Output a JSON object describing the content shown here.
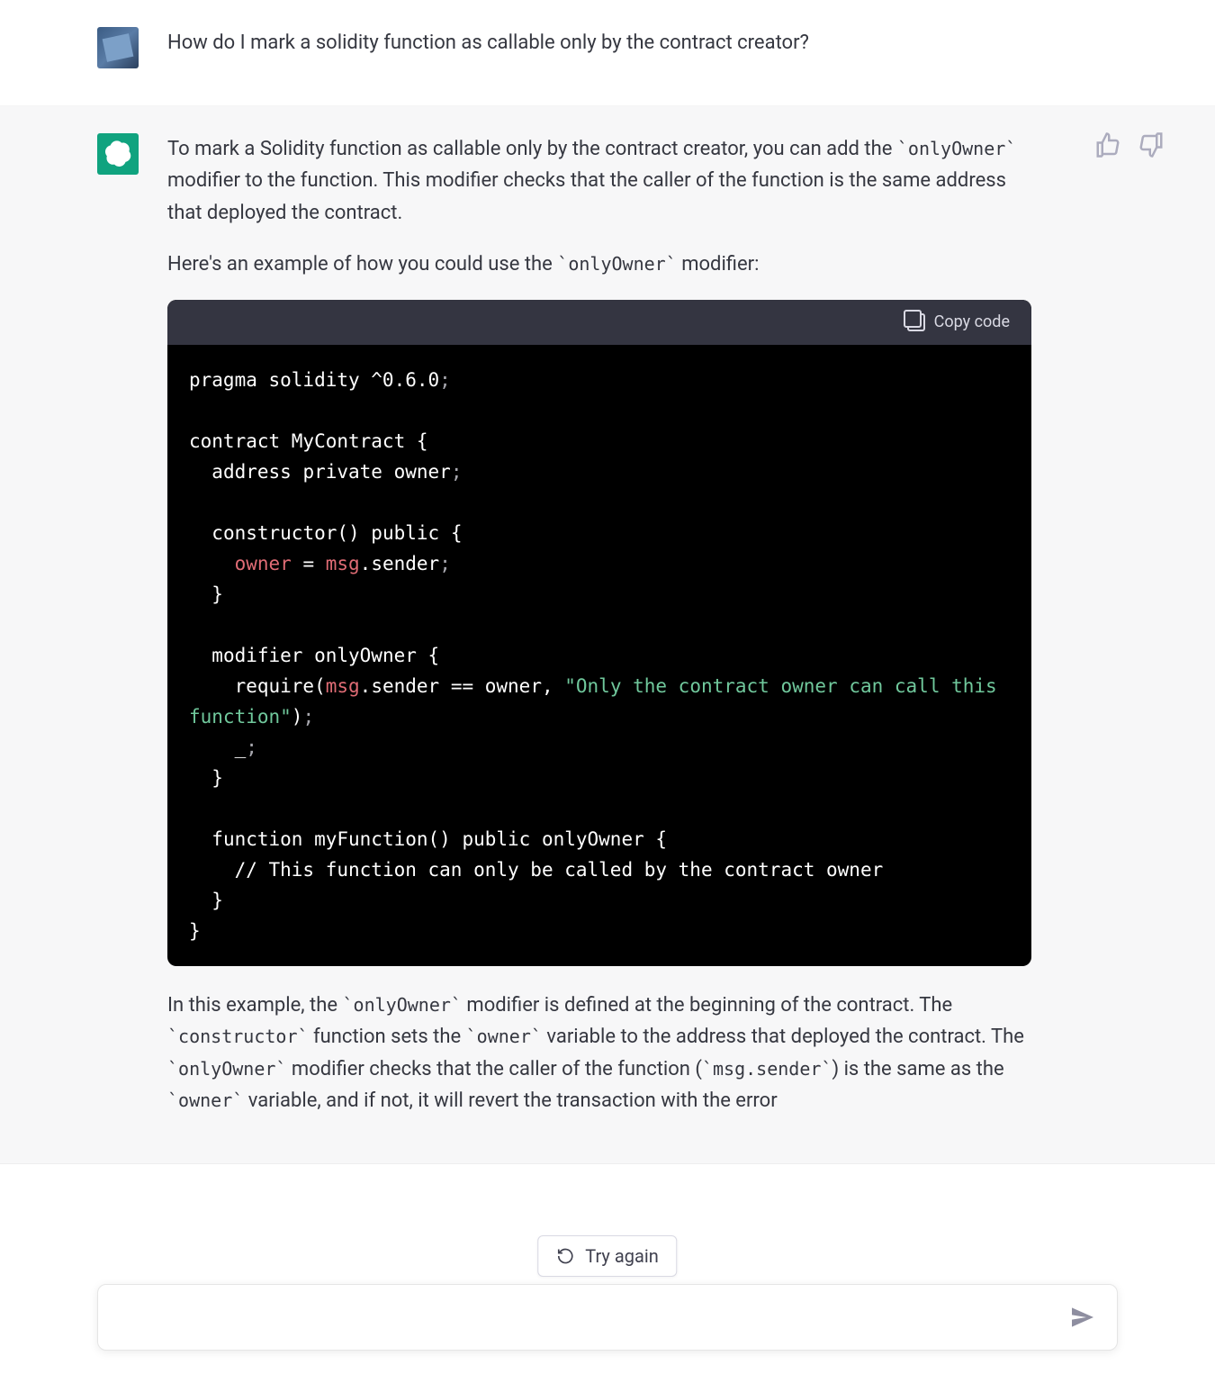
{
  "user": {
    "question": "How do I mark a solidity function as callable only by the contract creator?"
  },
  "assistant": {
    "para1_a": "To mark a Solidity function as callable only by the contract creator, you can add the ",
    "para1_code1": "`onlyOwner`",
    "para1_b": " modifier to the function. This modifier checks that the caller of the function is the same address that deployed the contract.",
    "para2_a": "Here's an example of how you could use the ",
    "para2_code1": "`onlyOwner`",
    "para2_b": " modifier:",
    "copy_label": "Copy code",
    "code": {
      "l1_a": "pragma solidity ^0.6.0",
      "l1_b": ";",
      "l2": "",
      "l3_a": "contract MyContract ",
      "l3_b": "{",
      "l4_a": "  address private owner",
      "l4_b": ";",
      "l5": "",
      "l6_a": "  constructor() public ",
      "l6_b": "{",
      "l7_a": "    ",
      "l7_b": "owner",
      "l7_c": " = ",
      "l7_d": "msg",
      "l7_e": ".sender",
      "l7_f": ";",
      "l8": "  }",
      "l9": "",
      "l10_a": "  modifier onlyOwner ",
      "l10_b": "{",
      "l11_a": "    require(",
      "l11_b": "msg",
      "l11_c": ".sender == owner, ",
      "l11_d": "\"Only the contract owner can call this function\"",
      "l11_e": ")",
      "l11_f": ";",
      "l12_a": "    _",
      "l12_b": ";",
      "l13": "  }",
      "l14": "",
      "l15_a": "  function myFunction() public onlyOwner ",
      "l15_b": "{",
      "l16": "    // This function can only be called by the contract owner",
      "l17": "  }",
      "l18": "}"
    },
    "para3_a": "In this example, the ",
    "para3_code1": "`onlyOwner`",
    "para3_b": " modifier is defined at the beginning of the contract. The ",
    "para3_code2": "`constructor`",
    "para3_c": " function sets the ",
    "para3_code3": "`owner`",
    "para3_d": " variable to the address that deployed the contract. The ",
    "para3_code4": "`onlyOwner`",
    "para3_e": " modifier checks that the caller of the function (",
    "para3_code5": "`msg.sender`",
    "para3_f": ") is the same as the ",
    "para3_code6": "`owner`",
    "para3_g": " variable, and if not, it will revert the transaction with the error"
  },
  "try_again_label": "Try again",
  "input_placeholder": ""
}
